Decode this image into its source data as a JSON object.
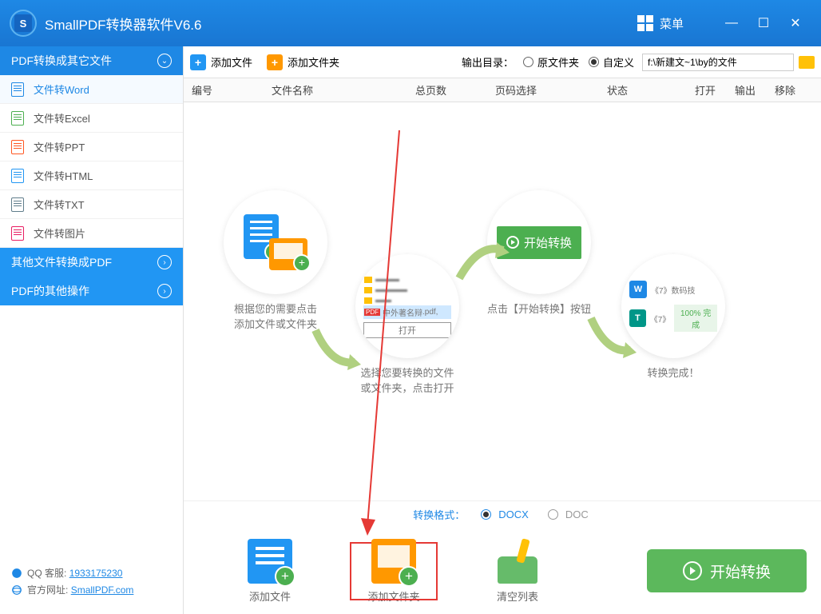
{
  "titlebar": {
    "title": "SmallPDF转换器软件V6.6",
    "menu": "菜单"
  },
  "sidebar": {
    "cat1": "PDF转换成其它文件",
    "items": [
      {
        "label": "文件转Word"
      },
      {
        "label": "文件转Excel"
      },
      {
        "label": "文件转PPT"
      },
      {
        "label": "文件转HTML"
      },
      {
        "label": "文件转TXT"
      },
      {
        "label": "文件转图片"
      }
    ],
    "cat2": "其他文件转换成PDF",
    "cat3": "PDF的其他操作"
  },
  "footer": {
    "qq_label": "QQ 客服:",
    "qq_value": "1933175230",
    "site_label": "官方网址:",
    "site_value": "SmallPDF.com"
  },
  "toolbar": {
    "add_file": "添加文件",
    "add_folder": "添加文件夹",
    "output_label": "输出目录：",
    "opt_src": "原文件夹",
    "opt_custom": "自定义",
    "path": "f:\\新建文~1\\by的文件"
  },
  "columns": {
    "num": "编号",
    "name": "文件名称",
    "pages": "总页数",
    "sel": "页码选择",
    "status": "状态",
    "open": "打开",
    "out": "输出",
    "rm": "移除"
  },
  "steps": {
    "s1a": "根据您的需要点击",
    "s1b": "添加文件或文件夹",
    "s2a": "选择您要转换的文件",
    "s2b": "或文件夹，点击打开",
    "s2_pdf": "中外著名辩",
    "s2_ext": ".pdf,",
    "s2_open": "打开",
    "s3": "点击【开始转换】按钮",
    "s3_btn": "开始转换",
    "s4": "转换完成！",
    "s4_w": "《7》数码技",
    "s4_t": "《7》",
    "s4_done": "100% 完成"
  },
  "format": {
    "label": "转换格式：",
    "docx": "DOCX",
    "doc": "DOC"
  },
  "bottom": {
    "add_file": "添加文件",
    "add_folder": "添加文件夹",
    "clear": "清空列表",
    "start": "开始转换"
  }
}
